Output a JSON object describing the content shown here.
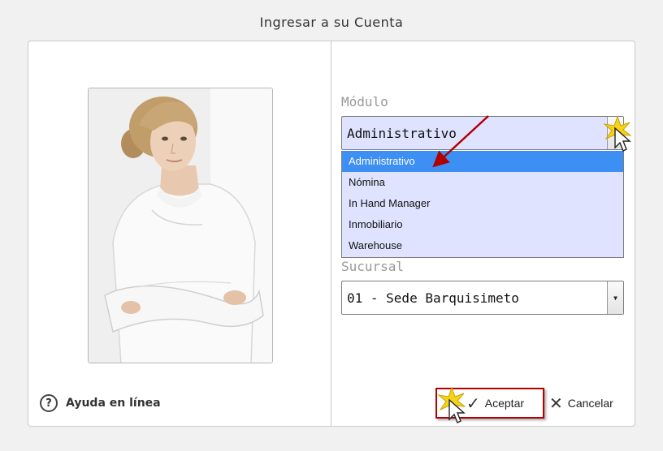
{
  "dialog": {
    "title": "Ingresar a su Cuenta"
  },
  "left_panel": {
    "photo_icon": "user-portrait",
    "help": {
      "icon": "question-circle-icon",
      "icon_glyph": "?",
      "label": "Ayuda en línea"
    }
  },
  "form": {
    "modulo": {
      "label": "Módulo",
      "value": "Administrativo",
      "options": [
        "Administrativo",
        "Nómina",
        "In Hand Manager",
        "Inmobiliario",
        "Warehouse"
      ],
      "selected_index": 0
    },
    "sucursal": {
      "label": "Sucursal",
      "value": "01 - Sede Barquisimeto"
    }
  },
  "actions": {
    "accept": {
      "icon": "check-icon",
      "glyph": "✓",
      "label": "Aceptar"
    },
    "cancel": {
      "icon": "close-icon",
      "glyph": "✕",
      "label": "Cancelar"
    }
  },
  "colors": {
    "accent": "#3d8ff3",
    "dropdown_bg": "#dfe3ff",
    "highlight_border": "#b30000",
    "annotation_arrow": "#b00000"
  }
}
